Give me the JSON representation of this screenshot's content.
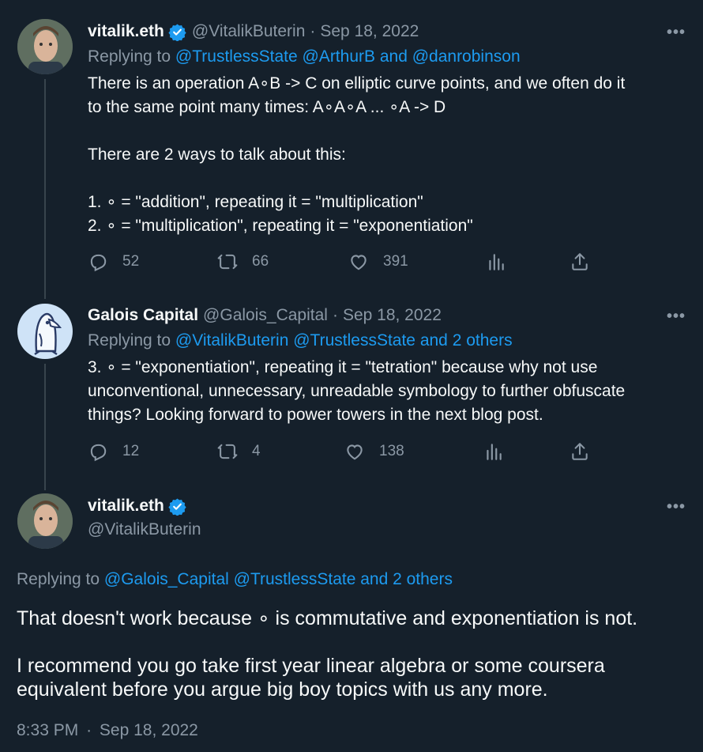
{
  "tweets": [
    {
      "name": "vitalik.eth",
      "handle": "@VitalikButerin",
      "sep": "·",
      "date": "Sep 18, 2022",
      "verified": true,
      "reply_prefix": "Replying to",
      "reply_targets": "@TrustlessState @ArthurB and @danrobinson",
      "text": "There is an operation A∘B -> C on elliptic curve points, and we often do it\nto the same point many times: A∘A∘A ... ∘A -> D\n\nThere are 2 ways to talk about this:\n\n1. ∘ = \"addition\", repeating it = \"multiplication\"\n2. ∘ = \"multiplication\", repeating it = \"exponentiation\"",
      "replies": "52",
      "retweets": "66",
      "likes": "391"
    },
    {
      "name": "Galois Capital",
      "handle": "@Galois_Capital",
      "sep": "·",
      "date": "Sep 18, 2022",
      "verified": false,
      "reply_prefix": "Replying to",
      "reply_targets": "@VitalikButerin @TrustlessState and 2 others",
      "text": "3. ∘ = \"exponentiation\", repeating it = \"tetration\" because why not use\nunconventional, unnecessary, unreadable symbology to further obfuscate\nthings?  Looking forward to power towers in the next blog post.",
      "replies": "12",
      "retweets": "4",
      "likes": "138"
    }
  ],
  "main_tweet": {
    "name": "vitalik.eth",
    "handle": "@VitalikButerin",
    "reply_prefix": "Replying to",
    "reply_targets": "@Galois_Capital @TrustlessState and 2 others",
    "text": "That doesn't work because ∘ is commutative and exponentiation is not.\n\nI recommend you go take first year linear algebra or some coursera\nequivalent before you argue big boy topics with us any more.",
    "time": "8:33 PM",
    "sep": "·",
    "date": "Sep 18, 2022"
  },
  "more_label": "•••",
  "colors": {
    "background": "#15202b",
    "link": "#1d9bf0",
    "muted": "#8b98a5",
    "verified": "#1d9bf0"
  },
  "icons": [
    "reply-icon",
    "retweet-icon",
    "like-icon",
    "views-icon",
    "share-icon",
    "verified-badge-icon",
    "more-icon"
  ]
}
